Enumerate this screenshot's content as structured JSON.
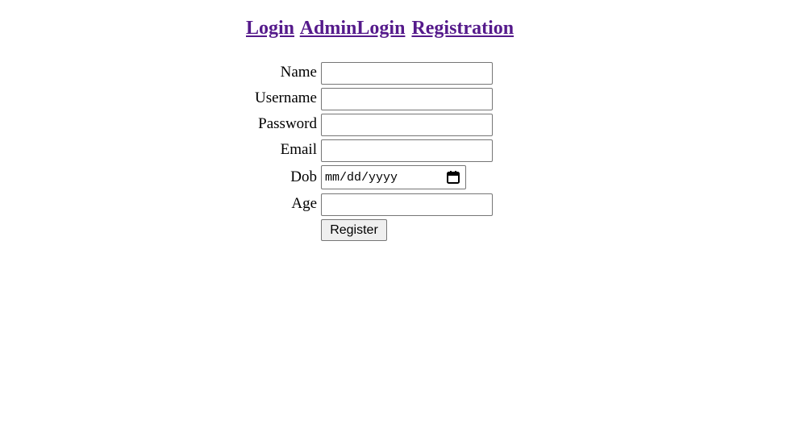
{
  "nav": {
    "links": [
      {
        "label": "Login"
      },
      {
        "label": "AdminLogin"
      },
      {
        "label": "Registration"
      }
    ]
  },
  "form": {
    "name": {
      "label": "Name",
      "value": ""
    },
    "username": {
      "label": "Username",
      "value": ""
    },
    "password": {
      "label": "Password",
      "value": ""
    },
    "email": {
      "label": "Email",
      "value": ""
    },
    "dob": {
      "label": "Dob",
      "placeholder": "mm/dd/yyyy",
      "icon": "calendar-icon"
    },
    "age": {
      "label": "Age",
      "value": ""
    },
    "submit_label": "Register"
  },
  "colors": {
    "link": "#551a8b",
    "button_bg": "#efefef",
    "border": "#767676"
  }
}
